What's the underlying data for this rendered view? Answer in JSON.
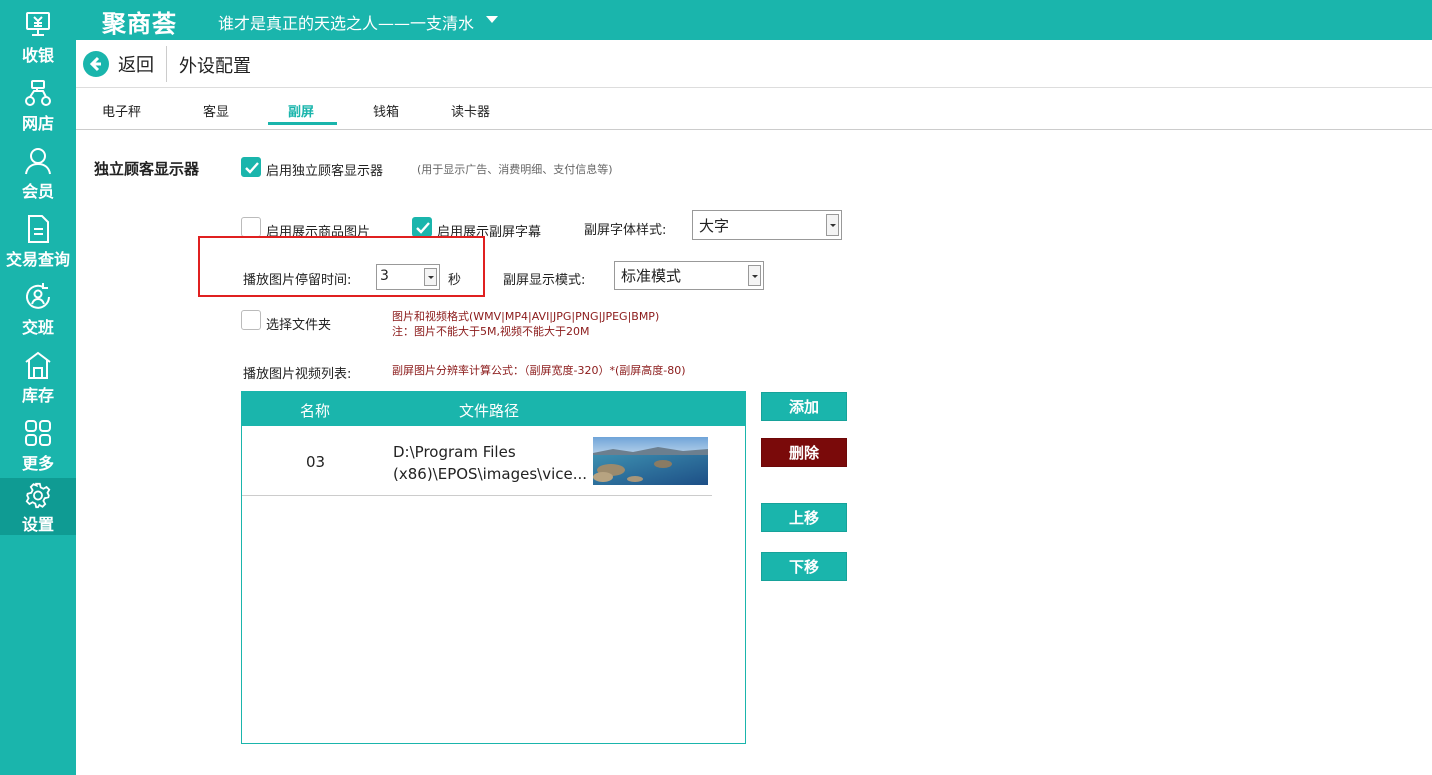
{
  "sidebar": {
    "items": [
      {
        "label": "收银",
        "icon": "cash-register-icon"
      },
      {
        "label": "网店",
        "icon": "scooter-icon"
      },
      {
        "label": "会员",
        "icon": "user-icon"
      },
      {
        "label": "交易查询",
        "icon": "document-icon"
      },
      {
        "label": "交班",
        "icon": "shift-handover-icon"
      },
      {
        "label": "库存",
        "icon": "warehouse-icon"
      },
      {
        "label": "更多",
        "icon": "grid-icon"
      },
      {
        "label": "设置",
        "icon": "gear-icon"
      }
    ],
    "active_index": 7,
    "bg_color": "#1ab5ac"
  },
  "topbar": {
    "logo": "聚商荟",
    "store_name": "谁才是真正的天选之人——一支清水"
  },
  "header": {
    "back_label": "返回",
    "page_title": "外设配置"
  },
  "tabs": [
    {
      "label": "电子秤"
    },
    {
      "label": "客显"
    },
    {
      "label": "副屏"
    },
    {
      "label": "钱箱"
    },
    {
      "label": "读卡器"
    }
  ],
  "active_tab": 2,
  "settings": {
    "section_title": "独立顾客显示器",
    "enable_display": {
      "label": "启用独立顾客显示器",
      "checked": true
    },
    "enable_hint": "(用于显示广告、消费明细、支付信息等)",
    "show_product_images": {
      "label": "启用展示商品图片",
      "checked": false
    },
    "show_subtitles": {
      "label": "启用展示副屏字幕",
      "checked": true
    },
    "font_style": {
      "label": "副屏字体样式:",
      "value": "大字"
    },
    "image_duration": {
      "label": "播放图片停留时间:",
      "value": "3",
      "unit": "秒"
    },
    "display_mode": {
      "label": "副屏显示模式:",
      "value": "标准模式"
    },
    "select_folder": {
      "label": "选择文件夹",
      "checked": false
    },
    "format_note_1": "图片和视频格式(WMV|MP4|AVI|JPG|PNG|JPEG|BMP)",
    "format_note_2": "注：图片不能大于5M,视频不能大于20M",
    "playlist_label": "播放图片视频列表:",
    "resolution_note": "副屏图片分辨率计算公式：（副屏宽度-320）*(副屏高度-80)"
  },
  "playlist": {
    "columns": [
      "名称",
      "文件路径"
    ],
    "rows": [
      {
        "name": "03",
        "path": "D:\\Program Files (x86)\\EPOS\\images\\vice..."
      }
    ]
  },
  "buttons": {
    "add": "添加",
    "delete": "删除",
    "move_up": "上移",
    "move_down": "下移"
  }
}
